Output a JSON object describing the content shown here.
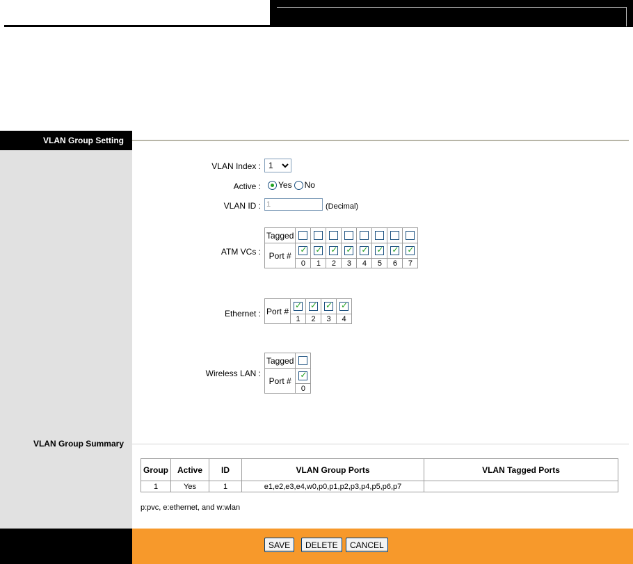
{
  "sections": {
    "setting_label": "VLAN Group Setting",
    "summary_label": "VLAN Group Summary"
  },
  "form": {
    "vlan_index_label": "VLAN Index :",
    "vlan_index_value": "1",
    "active_label": "Active :",
    "active_yes": "Yes",
    "active_no": "No",
    "active_selected": "Yes",
    "vlan_id_label": "VLAN ID :",
    "vlan_id_value": "1",
    "vlan_id_hint": "(Decimal)",
    "atm_label": "ATM VCs :",
    "ethernet_label": "Ethernet :",
    "wireless_label": "Wireless LAN :",
    "tagged_label": "Tagged",
    "port_label": "Port #"
  },
  "atm_ports": [
    "0",
    "1",
    "2",
    "3",
    "4",
    "5",
    "6",
    "7"
  ],
  "ethernet_ports": [
    "1",
    "2",
    "3",
    "4"
  ],
  "wireless_ports": [
    "0"
  ],
  "summary": {
    "headers": [
      "Group",
      "Active",
      "ID",
      "VLAN Group Ports",
      "VLAN Tagged Ports"
    ],
    "rows": [
      [
        "1",
        "Yes",
        "1",
        "e1,e2,e3,e4,w0,p0,p1,p2,p3,p4,p5,p6,p7",
        ""
      ]
    ],
    "note": "p:pvc, e:ethernet, and w:wlan"
  },
  "buttons": {
    "save": "SAVE",
    "delete": "DELETE",
    "cancel": "CANCEL"
  }
}
